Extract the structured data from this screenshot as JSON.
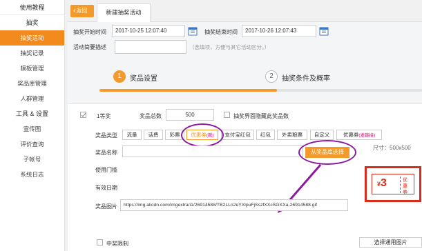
{
  "sidebar": {
    "header": "使用教程",
    "section1": "抽奖",
    "items1": [
      "抽奖活动",
      "抽奖记录",
      "模板管理",
      "奖品库管理",
      "人群管理"
    ],
    "section2": "工具 & 设置",
    "items2": [
      "宣传图",
      "评价查询",
      "子帐号",
      "系统日志"
    ]
  },
  "tabs": {
    "back": "返回",
    "active": "新建抽奖活动"
  },
  "form": {
    "start_label": "抽奖开始时间",
    "start_value": "2017-10-25 12:07:40",
    "end_label": "抽奖结束时间",
    "end_value": "2017-10-26 12:07:43",
    "desc_label": "活动简要描述",
    "desc_hint": "（选填项，方便与其它活动区分。）"
  },
  "steps": {
    "step1_num": "1",
    "step1_label": "奖品设置",
    "step2_num": "2",
    "step2_label": "抽奖条件及概率",
    "progress": 0.55
  },
  "prize": {
    "level": "1等奖",
    "total_label": "奖品总数",
    "total_value": "500",
    "hide_label": "抽奖界面隐藏此奖品数",
    "type_label": "奖品类型",
    "types": [
      "流量",
      "话费",
      "彩票"
    ],
    "coupon_type": "优惠券",
    "coupon_tag": "(新)",
    "types_more": [
      "支付宝红包",
      "红包",
      "外卖粮票",
      "自定义"
    ],
    "coupon_dev": "优惠券",
    "coupon_dev_tag": "(发链接)",
    "name_label": "奖品名称",
    "lib_button": "从奖品库选择",
    "size_hint": "尺寸：500x500",
    "threshold_label": "使用门槛",
    "validity_label": "有效日期",
    "image_label": "奖品图片",
    "image_url": "https://img.alicdn.com/imgextra/i1/26914588/TB2LLn2eYXlpuFjSszfXXcSGXXa-26914588.gif",
    "upload_button": "选择通用图片",
    "limit_label": "中奖限制"
  },
  "coupon_preview": {
    "yen": "¥",
    "amount": "3",
    "label": "优惠券"
  },
  "colors": {
    "accent": "#f39a2a",
    "annotation": "#8b1a9c",
    "coupon_red": "#d92a1b"
  }
}
